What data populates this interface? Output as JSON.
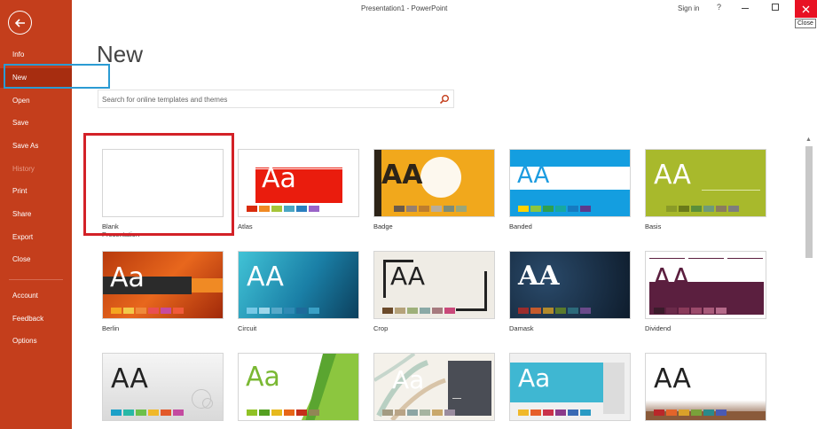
{
  "window": {
    "title": "Presentation1  -  PowerPoint",
    "sign_in": "Sign in",
    "help": "?",
    "close_tooltip": "Close"
  },
  "sidebar": {
    "items": [
      {
        "label": "Info"
      },
      {
        "label": "New"
      },
      {
        "label": "Open"
      },
      {
        "label": "Save"
      },
      {
        "label": "Save As"
      },
      {
        "label": "History"
      },
      {
        "label": "Print"
      },
      {
        "label": "Share"
      },
      {
        "label": "Export"
      },
      {
        "label": "Close"
      },
      {
        "label": "Account"
      },
      {
        "label": "Feedback"
      },
      {
        "label": "Options"
      }
    ]
  },
  "main": {
    "title": "New",
    "search": {
      "placeholder": "Search for online templates and themes"
    },
    "templates": [
      {
        "label": "Blank Presentation",
        "sample": ""
      },
      {
        "label": "Atlas",
        "sample": "Aa"
      },
      {
        "label": "Badge",
        "sample": "AA"
      },
      {
        "label": "Banded",
        "sample": "AA"
      },
      {
        "label": "Basis",
        "sample": "AA"
      },
      {
        "label": "Berlin",
        "sample": "Aa"
      },
      {
        "label": "Circuit",
        "sample": "AA"
      },
      {
        "label": "Crop",
        "sample": "AA"
      },
      {
        "label": "Damask",
        "sample": "AA"
      },
      {
        "label": "Dividend",
        "sample": "AA"
      },
      {
        "label": "",
        "sample": "AA"
      },
      {
        "label": "",
        "sample": "Aa"
      },
      {
        "label": "",
        "sample": "Aa"
      },
      {
        "label": "",
        "sample": "Aa"
      },
      {
        "label": "",
        "sample": "AA"
      }
    ]
  },
  "colors": {
    "brand": "#c43e1c",
    "nav_active": "#a72d10",
    "new_highlight": "#2b9bd3",
    "blank_highlight": "#d32127",
    "close_button": "#e81123"
  },
  "icons": {
    "back": "back-arrow-icon",
    "search": "search-icon",
    "minimize": "minimize-icon",
    "maximize": "maximize-icon",
    "close": "close-icon"
  }
}
